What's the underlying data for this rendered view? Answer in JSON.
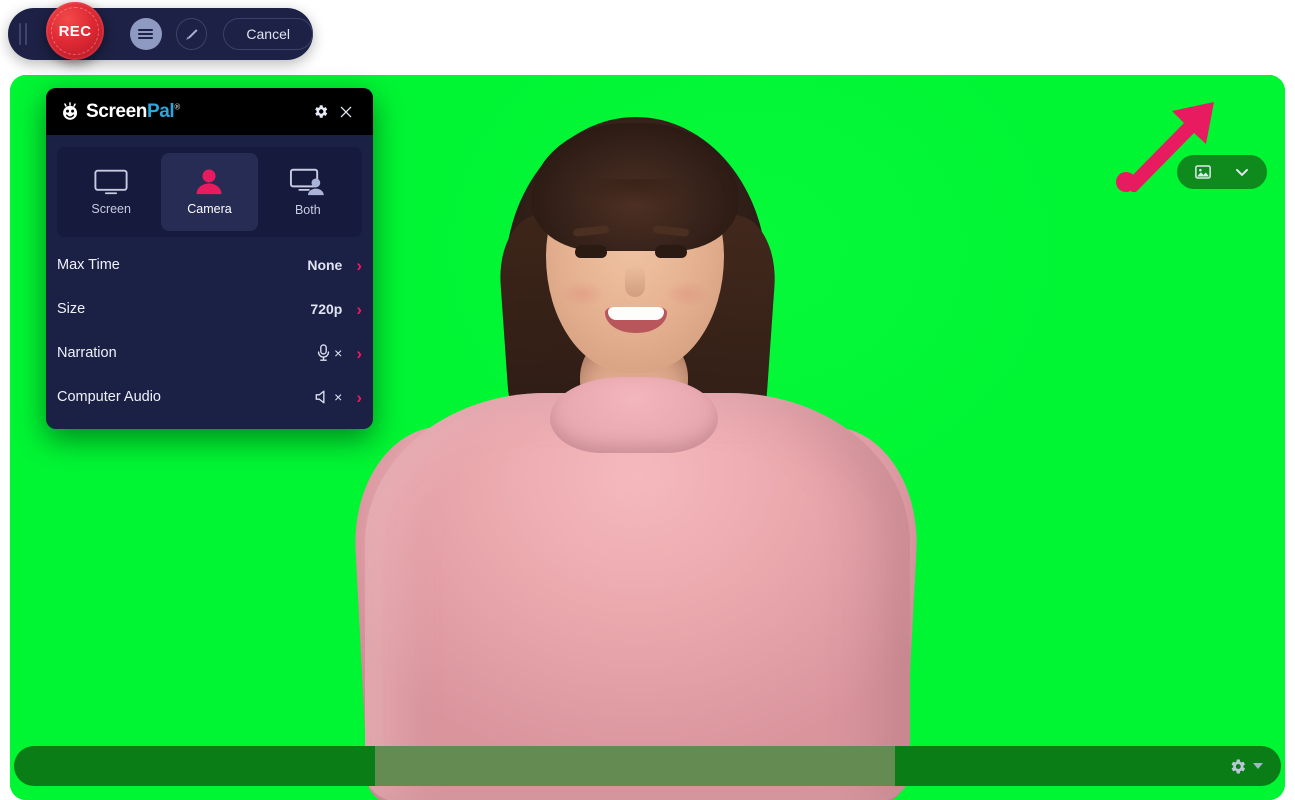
{
  "toolbar": {
    "drag_handle": "drag-handle",
    "record_label": "REC",
    "menu_label": "menu",
    "draw_label": "draw",
    "cancel_label": "Cancel"
  },
  "panel": {
    "logo_primary": "Screen",
    "logo_secondary": "Pal",
    "logo_tm": "®",
    "settings_icon": "gear-icon",
    "close_icon": "close-icon",
    "modes": [
      {
        "label": "Screen",
        "icon": "monitor-icon",
        "active": false
      },
      {
        "label": "Camera",
        "icon": "person-icon",
        "active": true
      },
      {
        "label": "Both",
        "icon": "monitor-person-icon",
        "active": false
      }
    ],
    "rows": [
      {
        "label": "Max Time",
        "value": "None",
        "icon": "",
        "chevron": "›"
      },
      {
        "label": "Size",
        "value": "720p",
        "icon": "",
        "chevron": "›"
      },
      {
        "label": "Narration",
        "value": "×",
        "icon": "microphone-off-icon",
        "chevron": "›"
      },
      {
        "label": "Computer Audio",
        "value": "×",
        "icon": "speaker-off-icon",
        "chevron": "›"
      }
    ]
  },
  "canvas": {
    "background_color": "#00f533",
    "description": "camera preview on green screen background"
  },
  "top_right_controls": {
    "image_button": "image-icon",
    "expand_button": "chevron-down-icon",
    "pill_color": "#0f8a1d"
  },
  "annotation": {
    "type": "arrow",
    "color": "#e81b60",
    "points_to": "image-background-button"
  },
  "bottom_bar": {
    "gear_icon": "gear-icon",
    "caret_icon": "caret-down-icon",
    "bar_color": "#0a7d16"
  },
  "colors": {
    "accent_pink": "#e81b60",
    "panel_bg": "#1b2045",
    "toolbar_bg": "#1d2145",
    "record_red": "#e02a35",
    "logo_blue": "#29a8df"
  }
}
